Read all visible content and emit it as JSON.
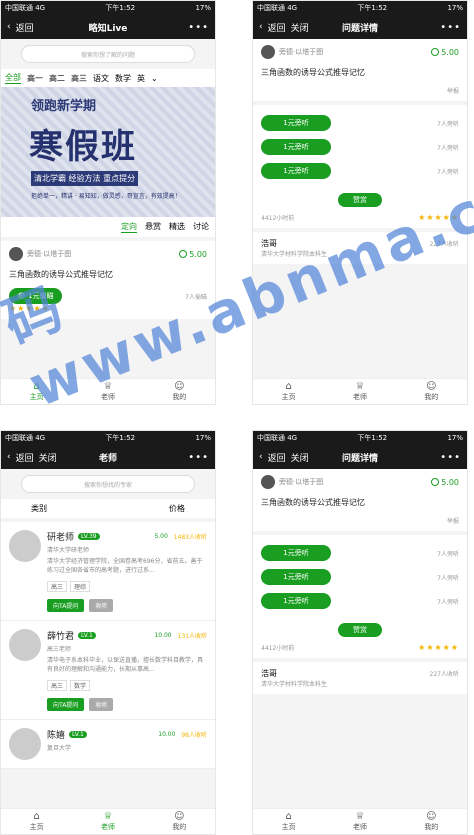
{
  "status": {
    "carrier": "中国联通 4G",
    "time": "下午1:52",
    "battery": "17%"
  },
  "home": {
    "nav": {
      "back": "返回",
      "title": "略知Live",
      "more": "•••"
    },
    "search": {
      "placeholder": "搜索你想了解的问题"
    },
    "categories": [
      "全部",
      "高一",
      "高二",
      "高三",
      "语文",
      "数学",
      "英"
    ],
    "banner": {
      "title": "领跑新学期",
      "headline": "寒假班",
      "tags": "清北学霸  经验方法  重点提分",
      "slogan": "拒绝单一，精讲 · 易知知，做灵感，哥宣言，有效提高！"
    },
    "tabs": [
      "定向",
      "悬赏",
      "精选",
      "讨论"
    ],
    "card": {
      "user": "旁德·以塔于图",
      "price": "5.00",
      "question": "三角函数的诱导公式推导记忆",
      "listen_label": "1元偷瞄",
      "listen_count": "7人偷瞄"
    },
    "bottom_nav": [
      "主页",
      "老师",
      "我的"
    ]
  },
  "teachers": {
    "nav": {
      "back": "返回",
      "close": "关闭",
      "title": "老师",
      "more": "•••"
    },
    "search": {
      "placeholder": "搜索你想找的专家"
    },
    "filters": [
      "类别",
      "价格"
    ],
    "list": [
      {
        "name": "研老师",
        "level": "LV.39",
        "school": "清华大学研老师",
        "price": "5.00",
        "count": "1483人收听",
        "desc": "清华大学经济管理学院，全国卷高考696分，省前五。善于练习过全国各省市的高考题，进行过系...",
        "tags": [
          "高三",
          "理综"
        ],
        "btn_ask": "向TA提问",
        "btn_fav": "收听"
      },
      {
        "name": "薛竹君",
        "level": "LV.1",
        "school": "高三老师",
        "price": "10.00",
        "count": "131人收听",
        "desc": "清华电子系本科毕业，以保送直播，擅长数学科目教学，具有良好的理解和沟通能力，长期从事高...",
        "tags": [
          "高三",
          "数学"
        ],
        "btn_ask": "向TA提问",
        "btn_fav": "收听"
      },
      {
        "name": "陈嬉",
        "level": "LV.1",
        "school": "复旦大学",
        "price": "10.00",
        "count": "98人收听"
      }
    ],
    "bottom_nav": [
      "主页",
      "老师",
      "我的"
    ]
  },
  "detail_a": {
    "nav": {
      "back": "返回",
      "close": "关闭",
      "title": "问题详情",
      "more": "•••"
    },
    "user": "旁德·以塔于图",
    "price": "5.00",
    "question": "三角函数的诱导公式推导记忆",
    "report": "举报",
    "answers": [
      {
        "label": "1元旁听",
        "count": "7人旁听"
      },
      {
        "label": "1元旁听",
        "count": "7人旁听"
      },
      {
        "label": "1元旁听",
        "count": "7人旁听"
      }
    ],
    "reward_btn": "赞赏",
    "time": "4412小时前",
    "comment_user": "浩哥",
    "comment_count": "227人收听",
    "comment_snippet": "清华大学材料学院本科生"
  },
  "detail_b": {
    "nav": {
      "back": "返回",
      "close": "关闭",
      "title": "问题详情",
      "more": "•••"
    },
    "user": "旁德·以塔于图",
    "price": "5.00",
    "question": "三角函数的诱导公式推导记忆",
    "report": "举报",
    "answers": [
      {
        "label": "1元旁听",
        "count": "7人旁听"
      },
      {
        "label": "1元旁听",
        "count": "7人旁听"
      },
      {
        "label": "1元旁听",
        "count": "7人旁听"
      }
    ],
    "reward_btn": "赞赏",
    "time": "4412小时前",
    "comment_user": "浩哥",
    "comment_count": "227人收听",
    "comment_snippet": "清华大学材料学院本科生"
  },
  "watermark": "码 www.abnma.c"
}
